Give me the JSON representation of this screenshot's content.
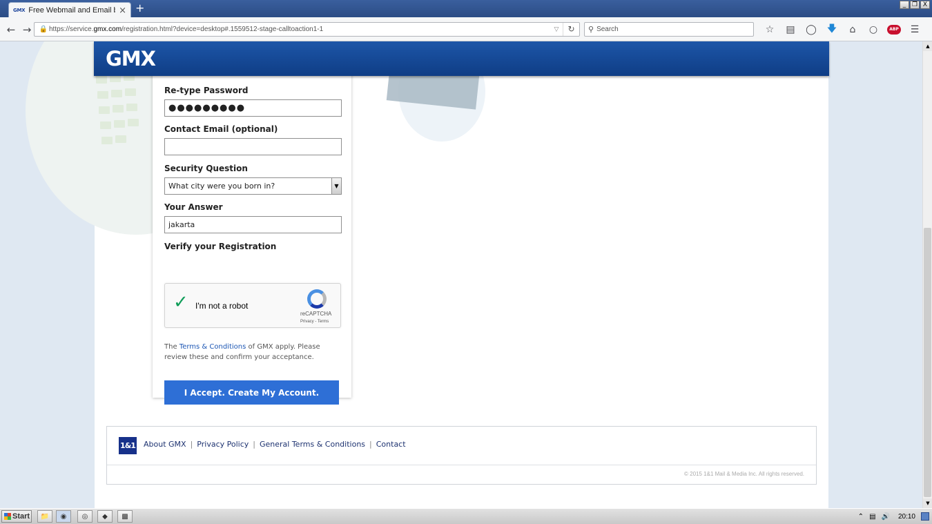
{
  "browser": {
    "tab": {
      "favicon": "GMX",
      "title": "Free Webmail and Email by G...",
      "close": "×"
    },
    "new_tab": "+",
    "window_controls": [
      "_",
      "❐",
      "X"
    ],
    "url": {
      "prefix": "https://service.",
      "domain": "gmx.com",
      "rest": "/registration.html?device=desktop#.1559512-stage-calltoaction1-1"
    },
    "search_placeholder": "Search"
  },
  "gmx_header": {
    "logo": "GMX"
  },
  "form": {
    "retype_password_label": "Re-type Password",
    "retype_password_value": "●●●●●●●●●",
    "contact_email_label": "Contact Email (optional)",
    "contact_email_value": "",
    "security_question_label": "Security Question",
    "security_question_value": "What city were you born in?",
    "answer_label": "Your Answer",
    "answer_value": "jakarta",
    "verify_label": "Verify your Registration",
    "captcha": {
      "text": "I'm not a robot",
      "brand": "reCAPTCHA",
      "links": "Privacy - Terms",
      "checked": true
    },
    "terms": {
      "before": "The ",
      "link": "Terms & Conditions",
      "after": " of GMX apply. Please review these and confirm your acceptance."
    },
    "accept_button": "I Accept. Create My Account."
  },
  "footer": {
    "logo": "1&1",
    "links": [
      "About GMX",
      "Privacy Policy",
      "General Terms & Conditions",
      "Contact"
    ],
    "separator": "|",
    "copyright": "© 2015 1&1 Mail & Media Inc. All rights reserved."
  },
  "taskbar": {
    "start": "Start",
    "clock": "20:10"
  },
  "colors": {
    "gmx_blue": "#1c449b",
    "accept_button": "#2e6fd6",
    "captcha_check": "#109d59"
  }
}
